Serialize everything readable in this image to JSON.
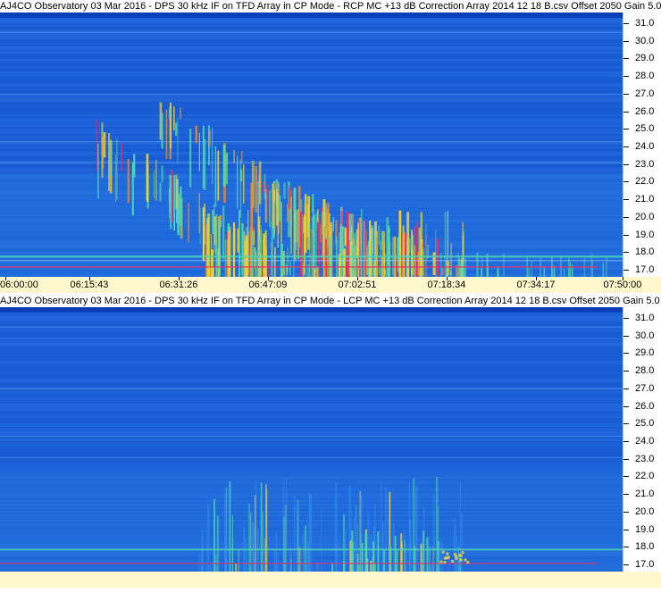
{
  "chart_data": [
    {
      "type": "heatmap",
      "title": "AJ4CO Observatory 03 Mar 2016 - DPS 30 kHz IF on TFD Array in CP Mode - RCP  MC +13 dB  Correction Array 2014 12 18 B.csv  Offset 2050  Gain 5.0",
      "x_ticks": [
        "06:00:00",
        "06:15:43",
        "06:31:26",
        "06:47:09",
        "07:02:51",
        "07:18:34",
        "07:34:17",
        "07:50:00"
      ],
      "y_ticks": [
        "31.0",
        "30.0",
        "29.0",
        "28.0",
        "27.0",
        "26.0",
        "25.0",
        "24.0",
        "23.0",
        "22.0",
        "21.0",
        "20.0",
        "19.0",
        "18.0",
        "17.0"
      ],
      "y_range": [
        16.6,
        31.6
      ],
      "colors": {
        "background": "#1a5fd6",
        "low": "#2f8ae8",
        "mid": "#4fd7b0",
        "high": "#f0d030",
        "peak": "#e8306a"
      }
    },
    {
      "type": "heatmap",
      "title": "AJ4CO Observatory 03 Mar 2016 - DPS 30 kHz IF on TFD Array in CP Mode - LCP  MC +13 dB  Correction Array 2014 12 18 B.csv  Offset 2050  Gain 5.0",
      "x_ticks": [],
      "y_ticks": [
        "31.0",
        "30.0",
        "29.0",
        "28.0",
        "27.0",
        "26.0",
        "25.0",
        "24.0",
        "23.0",
        "22.0",
        "21.0",
        "20.0",
        "19.0",
        "18.0",
        "17.0"
      ],
      "y_range": [
        16.6,
        31.6
      ],
      "colors": {
        "background": "#1a5fd6",
        "low": "#2f8ae8",
        "mid": "#4fd7b0",
        "high": "#f0d030",
        "peak": "#e8306a"
      }
    }
  ]
}
